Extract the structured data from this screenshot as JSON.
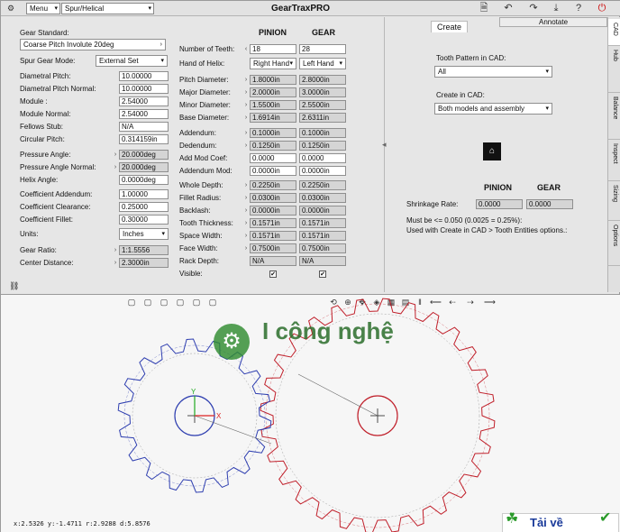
{
  "topbar": {
    "menu": "Menu",
    "mode": "Spur/Helical",
    "title": "GearTraxPRO"
  },
  "left": {
    "gear_standard_label": "Gear Standard:",
    "gear_standard": "Coarse Pitch Involute 20deg",
    "spur_mode_label": "Spur Gear Mode:",
    "spur_mode": "External Set",
    "params": [
      {
        "label": "Diametral Pitch:",
        "value": "10.00000"
      },
      {
        "label": "Diametral Pitch Normal:",
        "value": "10.00000"
      },
      {
        "label": "Module :",
        "value": "2.54000"
      },
      {
        "label": "Module Normal:",
        "value": "2.54000"
      },
      {
        "label": "Fellows Stub:",
        "value": "N/A"
      },
      {
        "label": "Circular Pitch:",
        "value": "0.314159in"
      },
      {
        "label": "Pressure Angle:",
        "value": "20.000deg"
      },
      {
        "label": "Pressure Angle Normal:",
        "value": "20.000deg"
      },
      {
        "label": "Helix Angle:",
        "value": "0.0000deg"
      },
      {
        "label": "Coefficient Addendum:",
        "value": "1.00000"
      },
      {
        "label": "Coefficient Clearance:",
        "value": "0.25000"
      },
      {
        "label": "Coefficient Fillet:",
        "value": "0.30000"
      },
      {
        "label": "Units:",
        "value": "Inches"
      },
      {
        "label": "Gear Ratio:",
        "value": "1:1.5556"
      },
      {
        "label": "Center Distance:",
        "value": "2.3000in"
      }
    ],
    "col_pinion": "PINION",
    "col_gear": "GEAR",
    "rows": [
      {
        "label": "Number of Teeth:",
        "p": "18",
        "g": "28"
      },
      {
        "label": "Hand of Helix:",
        "p": "Right Hand",
        "g": "Left Hand"
      },
      {
        "label": "Pitch Diameter:",
        "p": "1.8000in",
        "g": "2.8000in"
      },
      {
        "label": "Major Diameter:",
        "p": "2.0000in",
        "g": "3.0000in"
      },
      {
        "label": "Minor Diameter:",
        "p": "1.5500in",
        "g": "2.5500in"
      },
      {
        "label": "Base Diameter:",
        "p": "1.6914in",
        "g": "2.6311in"
      },
      {
        "label": "Addendum:",
        "p": "0.1000in",
        "g": "0.1000in"
      },
      {
        "label": "Dedendum:",
        "p": "0.1250in",
        "g": "0.1250in"
      },
      {
        "label": "Add Mod Coef:",
        "p": "0.0000",
        "g": "0.0000"
      },
      {
        "label": "Addendum Mod:",
        "p": "0.0000in",
        "g": "0.0000in"
      },
      {
        "label": "Whole Depth:",
        "p": "0.2250in",
        "g": "0.2250in"
      },
      {
        "label": "Fillet Radius:",
        "p": "0.0300in",
        "g": "0.0300in"
      },
      {
        "label": "Backlash:",
        "p": "0.0000in",
        "g": "0.0000in"
      },
      {
        "label": "Tooth Thickness:",
        "p": "0.1571in",
        "g": "0.1571in"
      },
      {
        "label": "Space Width:",
        "p": "0.1571in",
        "g": "0.1571in"
      },
      {
        "label": "Face Width:",
        "p": "0.7500in",
        "g": "0.7500in"
      },
      {
        "label": "Rack Depth:",
        "p": "N/A",
        "g": "N/A"
      },
      {
        "label": "Visible:",
        "p": "✔",
        "g": "✔"
      }
    ]
  },
  "right": {
    "tab_create": "Create",
    "tab_annotate": "Annotate",
    "tooth_pattern_label": "Tooth Pattern in CAD:",
    "tooth_pattern": "All",
    "create_in_label": "Create in CAD:",
    "create_in": "Both models and assembly",
    "pinion": "PINION",
    "gear": "GEAR",
    "shrink_label": "Shrinkage Rate:",
    "shrink_p": "0.0000",
    "shrink_g": "0.0000",
    "note1": "Must be <= 0.050 (0.0025 = 0.25%):",
    "note2": "Used with Create in CAD > Tooth Entities options.:"
  },
  "vtabs": [
    "CAD",
    "Hub",
    "Balance",
    "Inspect",
    "Sizing",
    "Options"
  ],
  "bottom": {
    "coords": "x:2.5326   y:-1.4711   r:2.9288   d:5.8576",
    "watermark": "Tải về",
    "brand": "I công nghệ",
    "axis_x": "X",
    "axis_y": "Y"
  },
  "colors": {
    "pinion": "#2f3fb0",
    "gear": "#c01f2a"
  }
}
